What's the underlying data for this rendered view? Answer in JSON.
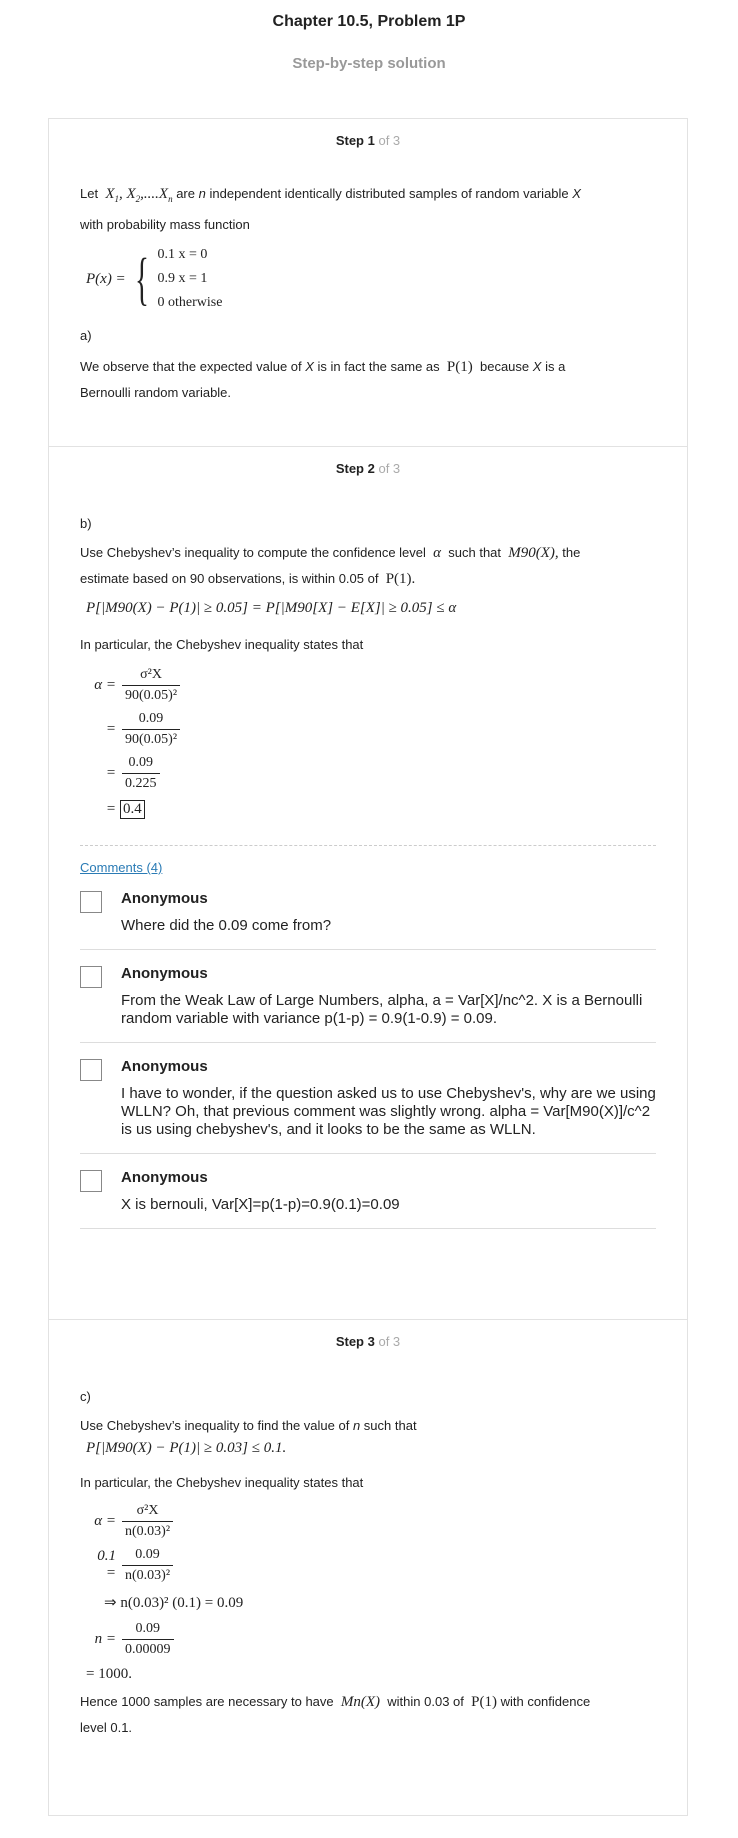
{
  "header": {
    "title": "Chapter 10.5, Problem 1P",
    "subtitle": "Step-by-step solution"
  },
  "steps": [
    {
      "label": "Step 1",
      "of": "of 3"
    },
    {
      "label": "Step 2",
      "of": "of 3"
    },
    {
      "label": "Step 3",
      "of": "of 3"
    }
  ],
  "step1": {
    "intro_pre": "Let",
    "intro_vars": "X1, X2,....Xn",
    "intro_post1": "are",
    "intro_n": "n",
    "intro_post2": "independent identically distributed samples of random variable",
    "intro_X": "X",
    "intro_line2": "with probability mass function",
    "pmf_lhs": "P(x) =",
    "pmf_cases": [
      "0.1  x = 0",
      "0.9  x = 1",
      "0  otherwise"
    ],
    "part": "a)",
    "obs_pre": "We observe that the expected value of",
    "obs_X": "X",
    "obs_mid": "is in fact the same as",
    "obs_P1": "P(1)",
    "obs_post": "because",
    "obs_X2": "X",
    "obs_end": "is a",
    "obs_line2": "Bernoulli random variable."
  },
  "step2": {
    "part": "b)",
    "line1_pre": "Use Chebyshev’s inequality to compute the confidence level",
    "alpha": "α",
    "line1_mid": "such that",
    "m90": "M90(X),",
    "line1_post": "the",
    "line2_pre": "estimate based on 90 observations, is within 0.05 of",
    "p1": "P(1).",
    "ineq": "P[|M90(X) − P(1)| ≥ 0.05] = P[|M90[X] − E[X]| ≥ 0.05] ≤ α",
    "particular": "In particular, the Chebyshev inequality states that",
    "eq": [
      {
        "lhs": "α =",
        "num": "σ²X",
        "den": "90(0.05)²"
      },
      {
        "lhs": "=",
        "num": "0.09",
        "den": "90(0.05)²"
      },
      {
        "lhs": "=",
        "num": "0.09",
        "den": "0.225"
      }
    ],
    "final_lhs": "=",
    "final": "0.4"
  },
  "comments": {
    "link": "Comments (4)",
    "items": [
      {
        "author": "Anonymous",
        "text": "Where did the 0.09 come from?"
      },
      {
        "author": "Anonymous",
        "text": "From the Weak Law of Large Numbers, alpha, a = Var[X]/nc^2. X is a Bernoulli random variable with variance p(1-p) = 0.9(1-0.9) = 0.09."
      },
      {
        "author": "Anonymous",
        "text": "I have to wonder, if the question asked us to use Chebyshev's, why are we using WLLN? Oh, that previous comment was slightly wrong. alpha = Var[M90(X)]/c^2 is us using chebyshev's, and it looks to be the same as WLLN."
      },
      {
        "author": "Anonymous",
        "text": "X is bernouli, Var[X]=p(1-p)=0.9(0.1)=0.09"
      }
    ]
  },
  "step3": {
    "part": "c)",
    "line1_pre": "Use Chebyshev’s inequality to find the value of",
    "n": "n",
    "line1_post": "such that",
    "ineq": "P[|M90(X) − P(1)| ≥ 0.03] ≤ 0.1.",
    "particular": "In particular, the Chebyshev inequality states that",
    "eq1": {
      "lhs": "α =",
      "num": "σ²X",
      "den": "n(0.03)²"
    },
    "eq2": {
      "lhs": "0.1 =",
      "num": "0.09",
      "den": "n(0.03)²"
    },
    "eq3": "⇒ n(0.03)² (0.1) = 0.09",
    "eq4": {
      "lhs": "n =",
      "num": "0.09",
      "den": "0.00009"
    },
    "eq5": "= 1000.",
    "hence_pre": "Hence 1000 samples are necessary to have",
    "mn": "Mn(X)",
    "hence_mid": "within 0.03 of",
    "p1": "P(1)",
    "hence_post": "with confidence",
    "hence_line2": "level 0.1."
  }
}
